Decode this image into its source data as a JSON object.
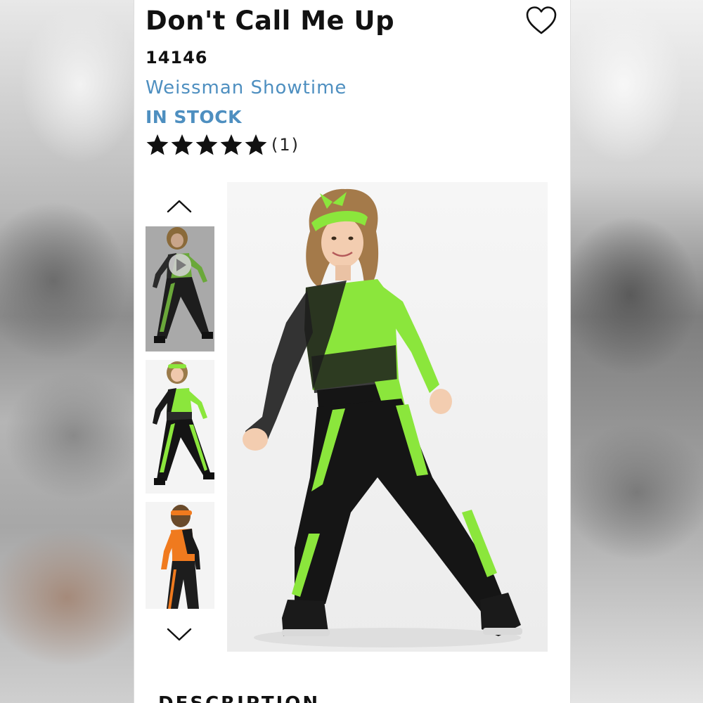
{
  "product": {
    "title": "Don't Call Me Up",
    "sku": "14146",
    "brand": "Weissman Showtime",
    "stock_status": "IN STOCK",
    "rating": {
      "stars": 5,
      "count_label": "(1)"
    }
  },
  "icons": {
    "favorite": "heart-outline-icon",
    "gallery_up": "chevron-up-icon",
    "gallery_down": "chevron-down-icon",
    "video_play": "play-icon",
    "rating_star": "star-filled-icon"
  },
  "gallery": {
    "thumbnails": [
      {
        "kind": "video",
        "selected": true
      },
      {
        "kind": "image",
        "selected": false
      },
      {
        "kind": "image",
        "selected": false
      }
    ]
  },
  "sections": {
    "description_heading": "DESCRIPTION"
  },
  "colors": {
    "brand_link": "#4e8fc0",
    "stock_text": "#4e8fc0",
    "costume_green": "#8be63c",
    "costume_black": "#111111",
    "costume_orange": "#f07a1e"
  }
}
